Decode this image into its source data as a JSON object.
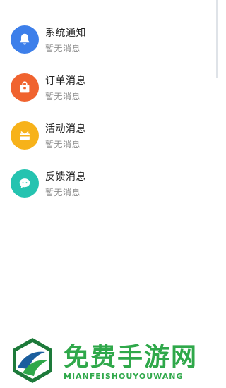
{
  "colors": {
    "notify": "#3d7fea",
    "order": "#f0632f",
    "activity": "#f7b21a",
    "feedback": "#25c3b0",
    "watermark": "#2fa84a"
  },
  "messages": [
    {
      "title": "系统通知",
      "subtitle": "暂无消息",
      "icon": "bell-icon"
    },
    {
      "title": "订单消息",
      "subtitle": "暂无消息",
      "icon": "bag-icon"
    },
    {
      "title": "活动消息",
      "subtitle": "暂无消息",
      "icon": "gift-icon"
    },
    {
      "title": "反馈消息",
      "subtitle": "暂无消息",
      "icon": "chat-bubble-icon"
    }
  ],
  "watermark": {
    "name": "免费手游网",
    "domain": "MIANFEISHOUYOUWANG"
  }
}
